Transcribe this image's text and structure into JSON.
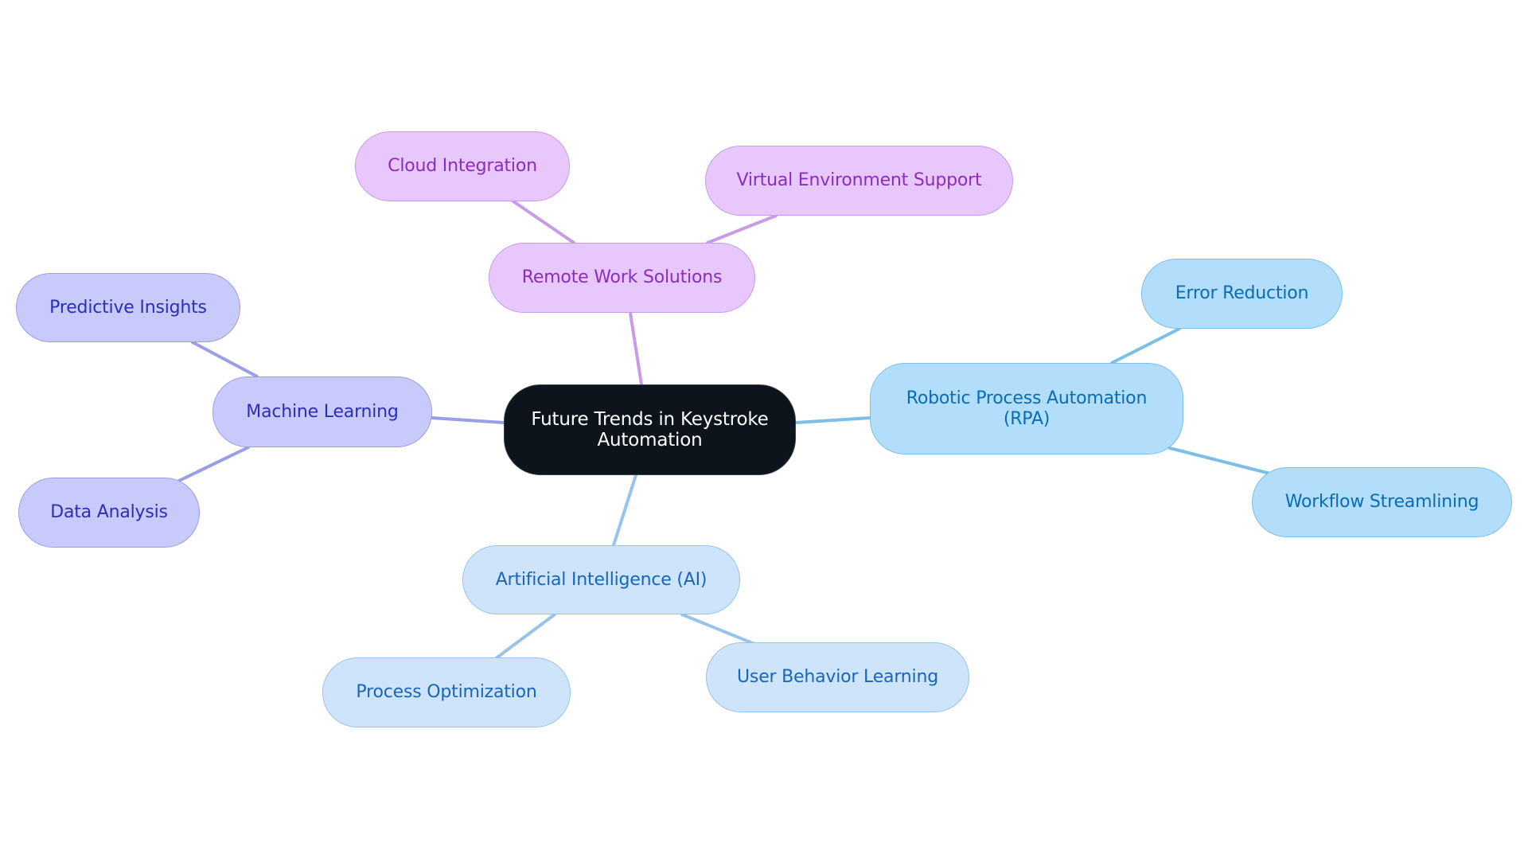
{
  "diagram": {
    "type": "mindmap",
    "root": {
      "id": "root",
      "label": "Future Trends in Keystroke\nAutomation"
    },
    "branches": [
      {
        "id": "remote",
        "label": "Remote Work Solutions",
        "theme": "purple",
        "edge_color": "#c89ae8",
        "children": [
          {
            "id": "cloud",
            "label": "Cloud Integration"
          },
          {
            "id": "virtual",
            "label": "Virtual Environment Support"
          }
        ]
      },
      {
        "id": "ml",
        "label": "Machine Learning",
        "theme": "indigo",
        "edge_color": "#9a9de8",
        "children": [
          {
            "id": "predictive",
            "label": "Predictive Insights"
          },
          {
            "id": "data",
            "label": "Data Analysis"
          }
        ]
      },
      {
        "id": "rpa",
        "label": "Robotic Process Automation\n(RPA)",
        "theme": "sky",
        "edge_color": "#7cbfe6",
        "children": [
          {
            "id": "error",
            "label": "Error Reduction"
          },
          {
            "id": "workflow",
            "label": "Workflow Streamlining"
          }
        ]
      },
      {
        "id": "ai",
        "label": "Artificial Intelligence (AI)",
        "theme": "light",
        "edge_color": "#98c3ea",
        "children": [
          {
            "id": "process",
            "label": "Process Optimization"
          },
          {
            "id": "user",
            "label": "User Behavior Learning"
          }
        ]
      }
    ],
    "colors": {
      "root_bg": "#0d141b",
      "root_text": "#ffffff",
      "purple_bg": "#e8c8fc",
      "purple_text": "#8a2dbf",
      "indigo_bg": "#c8cafc",
      "indigo_text": "#2a2fb5",
      "sky_bg": "#b2defc",
      "sky_text": "#0a6db3",
      "light_bg": "#cde4fb",
      "light_text": "#1965b8"
    }
  }
}
